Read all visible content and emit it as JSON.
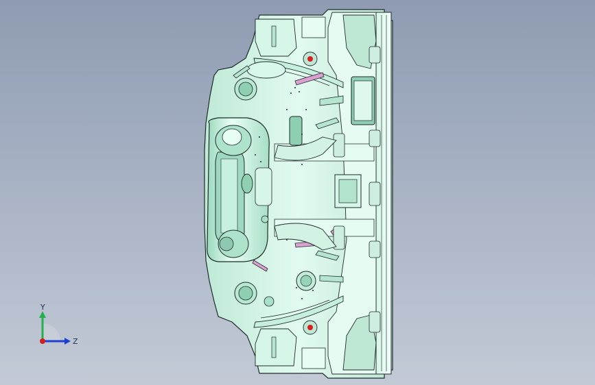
{
  "viewport": {
    "background_top": "#8e9bb2",
    "background_bottom": "#c3cad6"
  },
  "model": {
    "part_color": "#cdeee0",
    "part_highlight": "#ecfff6",
    "part_shadow": "#8fcfb2",
    "edge_color": "#1f2a2a",
    "hole_marker_color": "#d62020"
  },
  "triad": {
    "y_label": "Y",
    "z_label": "Z",
    "y_axis_color": "#22b14c",
    "z_axis_color": "#1f3fd0",
    "origin_color": "#d01f1f"
  }
}
